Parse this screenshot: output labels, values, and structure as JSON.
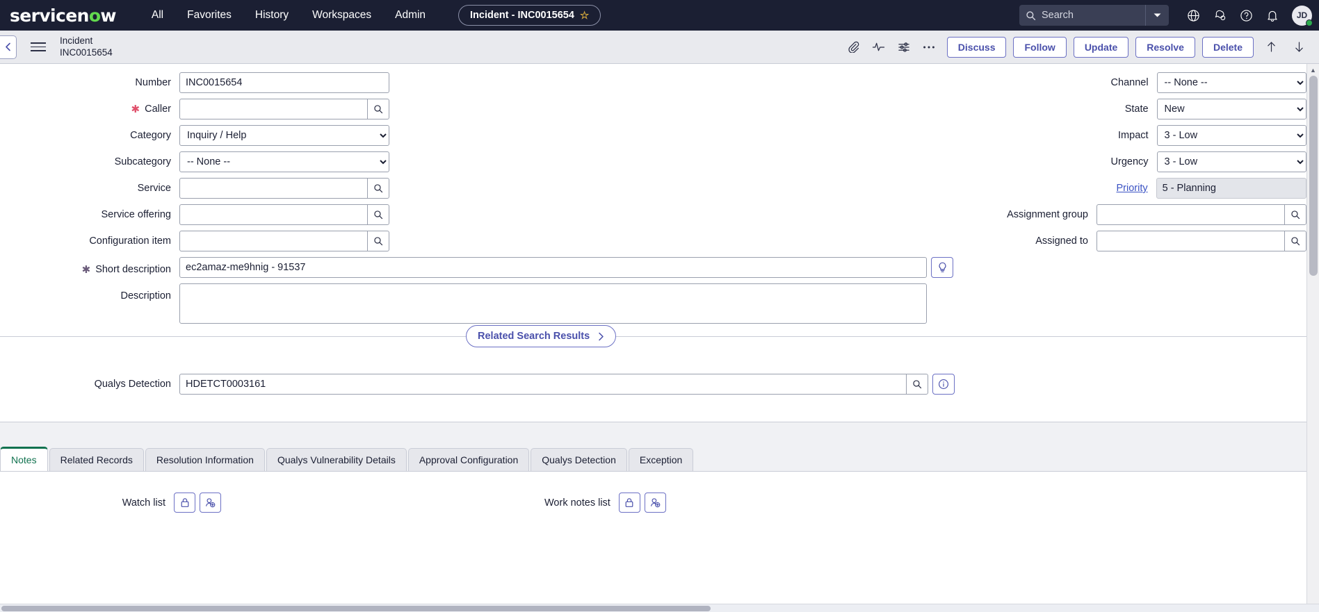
{
  "topnav": {
    "logo_text": "servicenow",
    "links": [
      {
        "label": "All"
      },
      {
        "label": "Favorites"
      },
      {
        "label": "History"
      },
      {
        "label": "Workspaces"
      },
      {
        "label": "Admin"
      }
    ],
    "record_tab": {
      "label": "Incident - INC0015654",
      "star": "☆"
    },
    "search": {
      "placeholder": "Search",
      "value": ""
    },
    "avatar_initials": "JD"
  },
  "formbar": {
    "title_line1": "Incident",
    "title_line2": "INC0015654",
    "buttons": [
      {
        "label": "Discuss"
      },
      {
        "label": "Follow"
      },
      {
        "label": "Update"
      },
      {
        "label": "Resolve"
      },
      {
        "label": "Delete"
      }
    ]
  },
  "form": {
    "left": {
      "number": {
        "label": "Number",
        "value": "INC0015654"
      },
      "caller": {
        "label": "Caller",
        "value": "",
        "required": true
      },
      "category": {
        "label": "Category",
        "value": "Inquiry / Help"
      },
      "subcategory": {
        "label": "Subcategory",
        "value": "-- None --"
      },
      "service": {
        "label": "Service",
        "value": ""
      },
      "service_offering": {
        "label": "Service offering",
        "value": ""
      },
      "configuration_item": {
        "label": "Configuration item",
        "value": ""
      }
    },
    "right": {
      "channel": {
        "label": "Channel",
        "value": "-- None --"
      },
      "state": {
        "label": "State",
        "value": "New"
      },
      "impact": {
        "label": "Impact",
        "value": "3 - Low"
      },
      "urgency": {
        "label": "Urgency",
        "value": "3 - Low"
      },
      "priority": {
        "label": "Priority",
        "value": "5 - Planning"
      },
      "assignment_group": {
        "label": "Assignment group",
        "value": ""
      },
      "assigned_to": {
        "label": "Assigned to",
        "value": ""
      }
    },
    "short_description": {
      "label": "Short description",
      "value": "ec2amaz-me9hnig - 91537"
    },
    "description": {
      "label": "Description",
      "value": ""
    },
    "related_search_results": {
      "label": "Related Search Results",
      "chevron": "›"
    },
    "qualys_detection": {
      "label": "Qualys Detection",
      "value": "HDETCT0003161"
    }
  },
  "tabs": [
    {
      "label": "Notes",
      "active": true
    },
    {
      "label": "Related Records",
      "active": false
    },
    {
      "label": "Resolution Information",
      "active": false
    },
    {
      "label": "Qualys Vulnerability Details",
      "active": false
    },
    {
      "label": "Approval Configuration",
      "active": false
    },
    {
      "label": "Qualys Detection",
      "active": false
    },
    {
      "label": "Exception",
      "active": false
    }
  ],
  "notes_panel": {
    "watch_list_label": "Watch list",
    "work_notes_list_label": "Work notes list"
  },
  "colors": {
    "nav_bg": "#1b1f33",
    "accent_purple": "#4a50ab",
    "active_tab_green": "#11724f",
    "required_red": "#e0506b",
    "link_blue": "#3b53c4"
  }
}
